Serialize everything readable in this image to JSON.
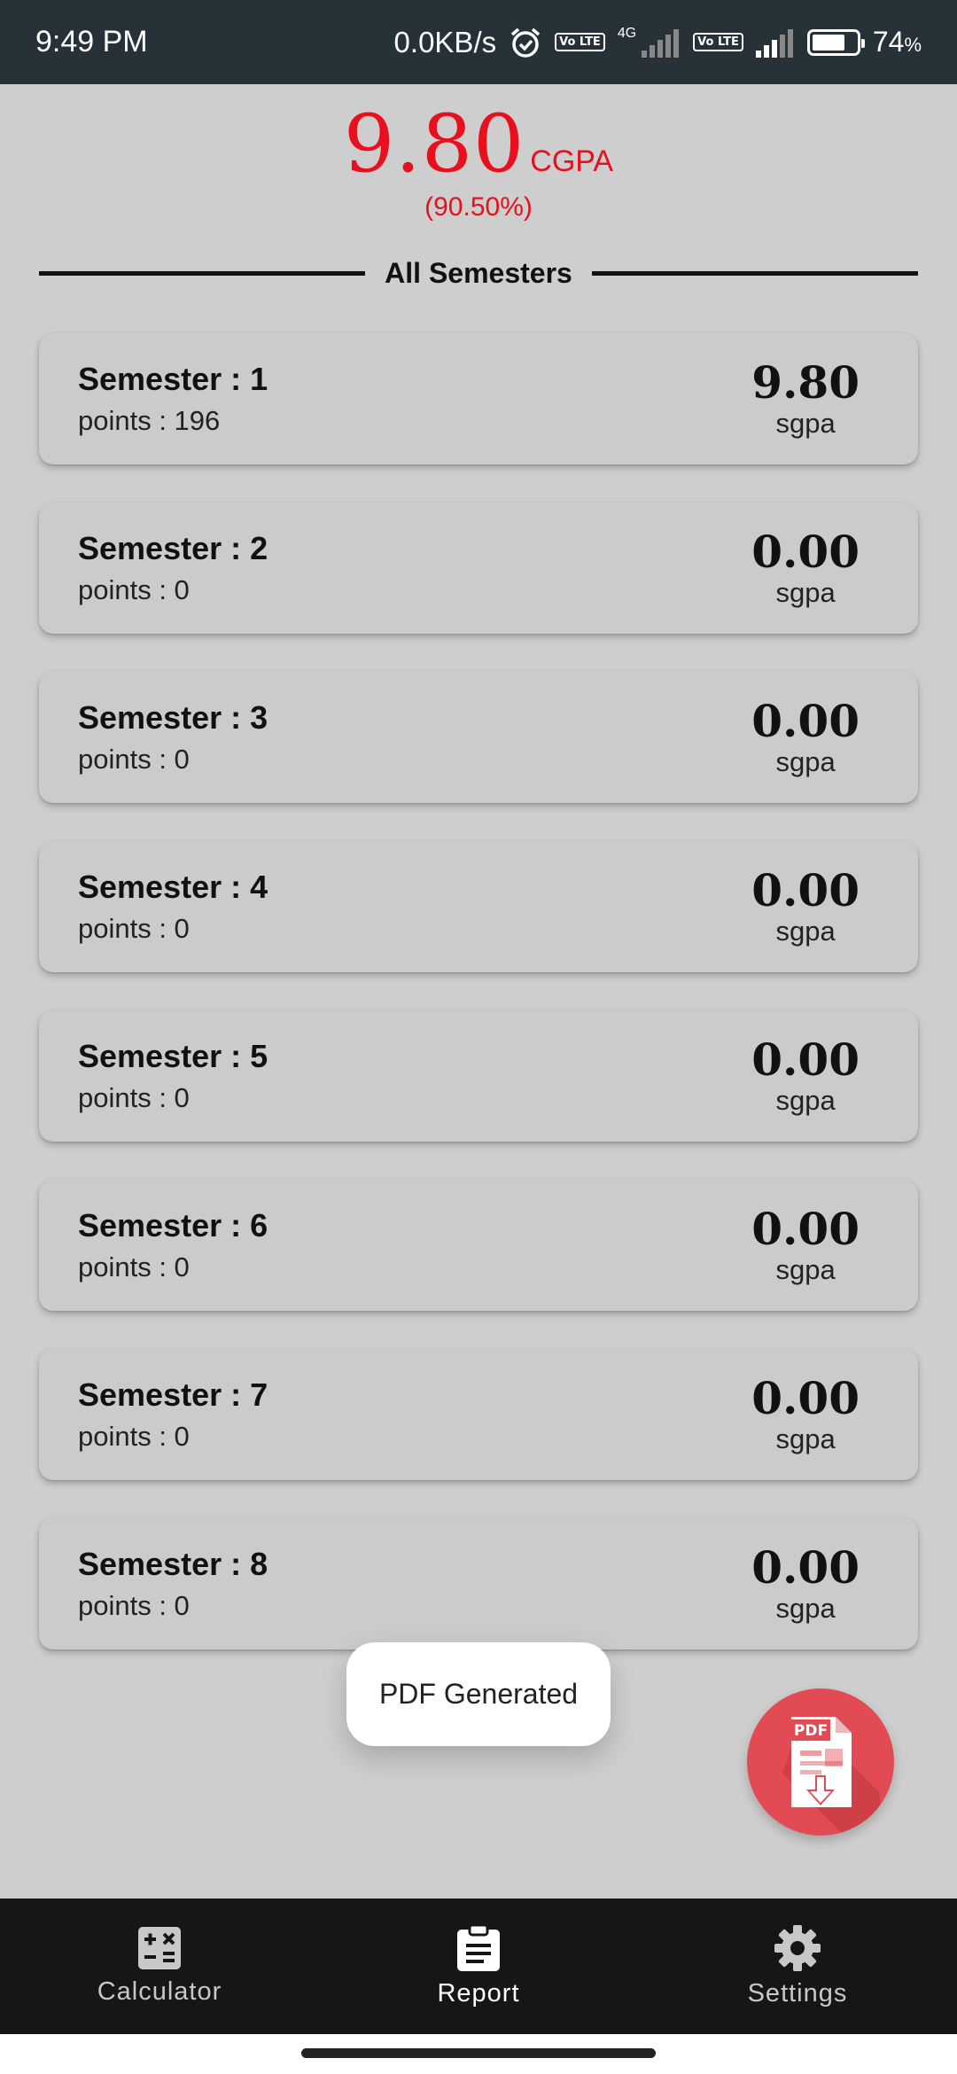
{
  "status_bar": {
    "time": "9:49 PM",
    "net_speed": "0.0KB/s",
    "volte_label": "Vo LTE",
    "network_type": "4G",
    "battery_percent": "74",
    "battery_unit": "%",
    "battery_level": 0.74
  },
  "header": {
    "cgpa_value": "9.80",
    "cgpa_label": "CGPA",
    "cgpa_percent": "(90.50%)",
    "accent_color": "#e8101d"
  },
  "section": {
    "title": "All Semesters"
  },
  "semesters": [
    {
      "title": "Semester : 1",
      "points": "points : 196",
      "sgpa": "9.80",
      "sgpa_label": "sgpa"
    },
    {
      "title": "Semester : 2",
      "points": "points : 0",
      "sgpa": "0.00",
      "sgpa_label": "sgpa"
    },
    {
      "title": "Semester : 3",
      "points": "points : 0",
      "sgpa": "0.00",
      "sgpa_label": "sgpa"
    },
    {
      "title": "Semester : 4",
      "points": "points : 0",
      "sgpa": "0.00",
      "sgpa_label": "sgpa"
    },
    {
      "title": "Semester : 5",
      "points": "points : 0",
      "sgpa": "0.00",
      "sgpa_label": "sgpa"
    },
    {
      "title": "Semester : 6",
      "points": "points : 0",
      "sgpa": "0.00",
      "sgpa_label": "sgpa"
    },
    {
      "title": "Semester : 7",
      "points": "points : 0",
      "sgpa": "0.00",
      "sgpa_label": "sgpa"
    },
    {
      "title": "Semester : 8",
      "points": "points : 0",
      "sgpa": "0.00",
      "sgpa_label": "sgpa"
    }
  ],
  "toast": {
    "message": "PDF Generated"
  },
  "fab": {
    "icon": "pdf-download-icon",
    "icon_text": "PDF",
    "color": "#e24b53"
  },
  "bottom_nav": {
    "items": [
      {
        "label": "Calculator",
        "icon": "calculator-icon",
        "active": false
      },
      {
        "label": "Report",
        "icon": "clipboard-icon",
        "active": true
      },
      {
        "label": "Settings",
        "icon": "gear-icon",
        "active": false
      }
    ]
  }
}
